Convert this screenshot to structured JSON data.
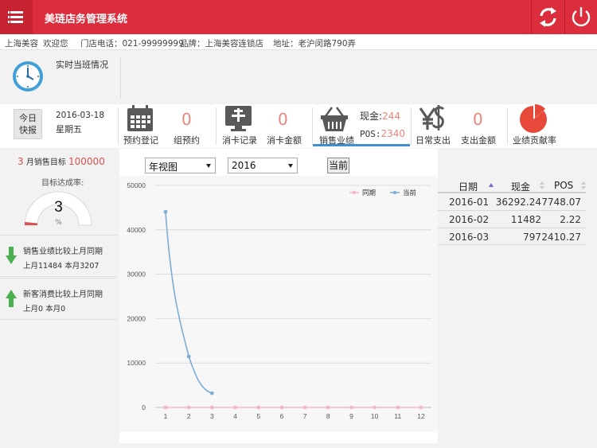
{
  "header": {
    "title": "美琏店务管理系统"
  },
  "info": {
    "shop": "上海美容",
    "welcome": "欢迎您",
    "phone": "门店电话：021-99999999",
    "brand": "品牌：上海美容连锁店",
    "address": "地址：老沪闵路790弄"
  },
  "shift": {
    "label": "实时当班情况"
  },
  "today": {
    "badge_line1": "今日",
    "badge_line2": "快报",
    "date": "2016-03-18",
    "weekday": "星期五"
  },
  "stats": {
    "appointment_label": "预约登记",
    "group_appointment_label": "组预约",
    "group_appointment_value": "0",
    "card_record_label": "消卡记录",
    "card_amount_label": "消卡金额",
    "card_amount_value": "0",
    "sales_label": "销售业绩",
    "cash_label": "现金:",
    "cash_value": "244",
    "pos_label": "POS:",
    "pos_value": "2340",
    "expense_label": "日常支出",
    "expense_amount_label": "支出金额",
    "expense_amount_value": "0",
    "contribution_label": "业绩贡献率"
  },
  "left": {
    "target_month": "3",
    "target_text": "月销售目标",
    "target_value": "100000",
    "rate_label": "目标达成率:",
    "rate_value": "3",
    "rate_unit": "%",
    "sales_cmp_title": "销售业绩比较上月同期",
    "sales_cmp_detail": "上月11484  本月3207",
    "new_cmp_title": "新客消费比较上月同期",
    "new_cmp_detail": "上月0  本月0"
  },
  "controls": {
    "view_select": "年视图",
    "year_select": "2016",
    "now_button": "当前"
  },
  "colors": {
    "header": "#dc2d3c",
    "accent_blue": "#3d8fd6",
    "value_red": "#e8857c",
    "series_prev": "#f4b8c4",
    "series_current": "#7aaed8"
  },
  "chart_data": {
    "type": "line",
    "x": [
      1,
      2,
      3,
      4,
      5,
      6,
      7,
      8,
      9,
      10,
      11,
      12
    ],
    "ylim": [
      0,
      50000
    ],
    "yticks": [
      0,
      10000,
      20000,
      30000,
      40000,
      50000
    ],
    "ytick_labels": [
      "0",
      "10000",
      "20000",
      "30000",
      "40000",
      "50000"
    ],
    "xtick_labels": [
      "1",
      "2",
      "3",
      "4",
      "5",
      "6",
      "7",
      "8",
      "9",
      "10",
      "11",
      "12"
    ],
    "legend_position": "top-right",
    "grid": true,
    "series": [
      {
        "name": "同期",
        "values": [
          0,
          0,
          0,
          0,
          0,
          0,
          0,
          0,
          0,
          0,
          0,
          0
        ]
      },
      {
        "name": "当前",
        "values": [
          44040.31,
          11484.22,
          3207.27
        ]
      }
    ]
  },
  "table": {
    "headers": [
      "日期",
      "现金",
      "POS"
    ],
    "rows": [
      [
        "2016-01",
        "36292.24",
        "7748.07"
      ],
      [
        "2016-02",
        "11482",
        "2.22"
      ],
      [
        "2016-03",
        "797",
        "2410.27"
      ]
    ]
  }
}
